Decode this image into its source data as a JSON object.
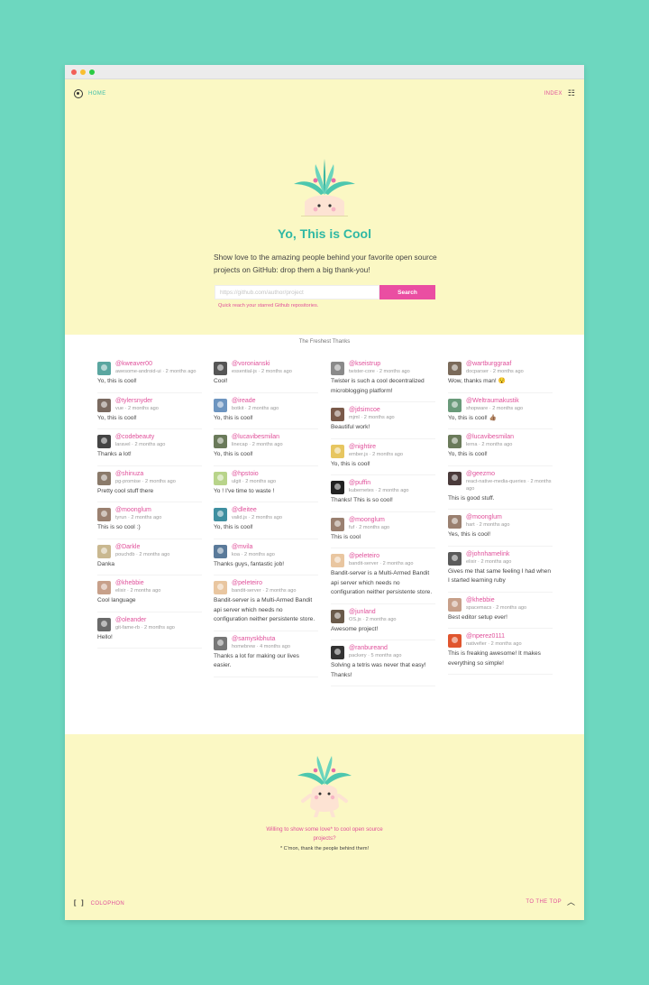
{
  "window": {
    "buttons": [
      {
        "name": "close",
        "color": "#f25f58"
      },
      {
        "name": "minimize",
        "color": "#f9be2f"
      },
      {
        "name": "maximize",
        "color": "#2acb42"
      }
    ]
  },
  "nav": {
    "home_label": "HOME",
    "index_label": "INDEX"
  },
  "hero": {
    "title": "Yo, This is Cool",
    "description": "Show love to the amazing people behind your favorite open source projects on GitHub: drop them a big thank-you!",
    "search_placeholder": "https://github.com/author/project",
    "search_button": "Search",
    "hint": "Quick reach your starred Github repositories."
  },
  "thanks": {
    "heading": "The Freshest Thanks",
    "columns": [
      [
        {
          "user": "@kweaver00",
          "meta": "awesome-android-ui · 2 months ago",
          "message": "Yo, this is cool!",
          "avatar_color": "#5aa6a0"
        },
        {
          "user": "@tylersnyder",
          "meta": "vue · 2 months ago",
          "message": "Yo, this is cool!",
          "avatar_color": "#7a6a60"
        },
        {
          "user": "@codebeauty",
          "meta": "laravel · 2 months ago",
          "message": "Thanks a lot!",
          "avatar_color": "#444444"
        },
        {
          "user": "@shinuza",
          "meta": "pg-promise · 2 months ago",
          "message": "Pretty cool stuff there",
          "avatar_color": "#8a7a6a"
        },
        {
          "user": "@moonglum",
          "meta": "tyrun · 2 months ago",
          "message": "This is so cool :)",
          "avatar_color": "#9a8070"
        },
        {
          "user": "@Darkle",
          "meta": "pouchdb · 2 months ago",
          "message": "Danka",
          "avatar_color": "#c9b890"
        },
        {
          "user": "@khebbie",
          "meta": "elixir · 2 months ago",
          "message": "Cool language",
          "avatar_color": "#c7a08a"
        },
        {
          "user": "@oleander",
          "meta": "git-fame-rb · 2 months ago",
          "message": "Hello!",
          "avatar_color": "#6a6a6a"
        }
      ],
      [
        {
          "user": "@voronianski",
          "meta": "essential-js · 2 months ago",
          "message": "Cool!",
          "avatar_color": "#555555"
        },
        {
          "user": "@ireade",
          "meta": "botkit · 2 months ago",
          "message": "Yo, this is cool!",
          "avatar_color": "#6d95c0"
        },
        {
          "user": "@lucavibesmilan",
          "meta": "linecap · 2 months ago",
          "message": "Yo, this is cool!",
          "avatar_color": "#6a7a5a"
        },
        {
          "user": "@hpstoio",
          "meta": "ulgit · 2 months ago",
          "message": "Yo ! I've time to waste !",
          "avatar_color": "#b8d48a"
        },
        {
          "user": "@dleitee",
          "meta": "valid.js · 2 months ago",
          "message": "Yo, this is cool!",
          "avatar_color": "#3f8fa0"
        },
        {
          "user": "@mvila",
          "meta": "koa · 2 months ago",
          "message": "Thanks guys, fantastic job!",
          "avatar_color": "#5a7a9a"
        },
        {
          "user": "@peleteiro",
          "meta": "bandit-server · 2 months ago",
          "message": "Bandit-server is a Multi-Armed Bandit api server which needs no configuration neither persistente store.",
          "avatar_color": "#e9c6a0"
        },
        {
          "user": "@samyskbhuta",
          "meta": "homebrew · 4 months ago",
          "message": "Thanks a lot for making our lives easier.",
          "avatar_color": "#777777"
        }
      ],
      [
        {
          "user": "@kseistrup",
          "meta": "twister-core · 2 months ago",
          "message": "Twister is such a cool decentralized microblogging platform!",
          "avatar_color": "#8a8a8a"
        },
        {
          "user": "@jdsimcoe",
          "meta": "mjml · 2 months ago",
          "message": "Beautiful work!",
          "avatar_color": "#7a5a4a"
        },
        {
          "user": "@nightire",
          "meta": "ember.js · 2 months ago",
          "message": "Yo, this is cool!",
          "avatar_color": "#e7c660"
        },
        {
          "user": "@puffin",
          "meta": "kubernetes · 2 months ago",
          "message": "Thanks! This is so cool!",
          "avatar_color": "#222222"
        },
        {
          "user": "@moonglum",
          "meta": "fuf · 2 months ago",
          "message": "This is cool",
          "avatar_color": "#9a8070"
        },
        {
          "user": "@peleteiro",
          "meta": "bandit-server · 2 months ago",
          "message": "Bandit-server is a Multi-Armed Bandit api server which needs no configuration neither persistente store.",
          "avatar_color": "#e9c6a0"
        },
        {
          "user": "@junland",
          "meta": "OS.js · 2 months ago",
          "message": "Awesome project!",
          "avatar_color": "#6a5a4a"
        },
        {
          "user": "@ranbureand",
          "meta": "packery · 5 months ago",
          "message": "Solving a tetris was never that easy! Thanks!",
          "avatar_color": "#333333"
        }
      ],
      [
        {
          "user": "@wartburggraaf",
          "meta": "docparser · 2 months ago",
          "message": "Wow, thanks man! 😯",
          "avatar_color": "#7a6a5a"
        },
        {
          "user": "@Weltraumakustik",
          "meta": "shopware · 2 months ago",
          "message": "Yo, this is cool! 👍🏽",
          "avatar_color": "#6a9a7a"
        },
        {
          "user": "@lucavibesmilan",
          "meta": "lerna · 2 months ago",
          "message": "Yo, this is cool!",
          "avatar_color": "#6a7a5a"
        },
        {
          "user": "@geezmo",
          "meta": "react-native-media-queries · 2 months ago",
          "message": "This is good stuff.",
          "avatar_color": "#4a3a3a"
        },
        {
          "user": "@moonglum",
          "meta": "hart · 2 months ago",
          "message": "Yes, this is cool!",
          "avatar_color": "#9a8070"
        },
        {
          "user": "@johnhamelink",
          "meta": "elixir · 2 months ago",
          "message": "Gives me that same feeling I had when I started learning ruby",
          "avatar_color": "#5a5a5a"
        },
        {
          "user": "@khebbie",
          "meta": "spacemacs · 2 months ago",
          "message": "Best editor setup ever!",
          "avatar_color": "#c7a08a"
        },
        {
          "user": "@nperez0111",
          "meta": "nativefier · 2 months ago",
          "message": "This is freaking awesome! It makes everything so simple!",
          "avatar_color": "#e0552e"
        }
      ]
    ]
  },
  "footer": {
    "cta": "Willing to show some love* to cool open source projects?",
    "note": "* C'mon, thank the people behind them!",
    "colophon_label": "COLOPHON",
    "totop_label": "TO THE TOP"
  },
  "colors": {
    "background": "#6dd7bf",
    "cream": "#fbf8c4",
    "teal": "#2fb8a4",
    "pink": "#ea4ea2"
  }
}
